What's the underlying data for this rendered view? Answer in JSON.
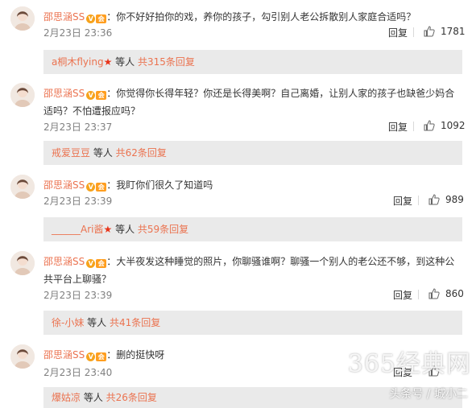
{
  "comments": [
    {
      "user": "邵思涵SS",
      "text": "：你不好好拍你的戏，养你的孩子，勾引别人老公拆散别人家庭合适吗？",
      "date": "2月23日 23:36",
      "reply_label": "回复",
      "likes": "1781",
      "sub_user": "a桐木flying",
      "sub_mid": " 等人 ",
      "sub_count": "共315条回复",
      "sub_has_star": true
    },
    {
      "user": "邵思涵SS",
      "text": "：你觉得你长得年轻？你还是长得美啊？自己离婚，让别人家的孩子也缺爸少妈合适吗？不怕遭报应吗？",
      "date": "2月23日 23:37",
      "reply_label": "回复",
      "likes": "1092",
      "sub_user": "戒爱豆豆",
      "sub_mid": " 等人 ",
      "sub_count": "共62条回复",
      "sub_has_star": false
    },
    {
      "user": "邵思涵SS",
      "text": "：我盯你们很久了知道吗",
      "date": "2月23日 23:39",
      "reply_label": "回复",
      "likes": "989",
      "sub_user": "______Ari酱",
      "sub_mid": " 等人 ",
      "sub_count": "共59条回复",
      "sub_has_star": true
    },
    {
      "user": "邵思涵SS",
      "text": "：大半夜发这种睡觉的照片，你聊骚谁啊？聊骚一个别人的老公还不够，到这种公共平台上聊骚？",
      "date": "2月23日 23:39",
      "reply_label": "回复",
      "likes": "860",
      "sub_user": "徐-小妹",
      "sub_mid": " 等人 ",
      "sub_count": "共41条回复",
      "sub_has_star": false
    },
    {
      "user": "邵思涵SS",
      "text": "：删的挺快呀",
      "date": "2月23日 23:40",
      "reply_label": "回复",
      "likes": "",
      "sub_user": "爆姑凉",
      "sub_mid": " 等人 ",
      "sub_count": "共26条回复",
      "sub_has_star": false
    }
  ],
  "badges": {
    "verified": "V",
    "member": "会"
  },
  "icons": {
    "like": "thumbs-up-icon",
    "star": "star-icon"
  },
  "watermark": {
    "main": "365经典网",
    "sub": "头条号 / 城小二"
  },
  "colors": {
    "username": "#eb7350",
    "date": "#808080",
    "sub_bg": "#eaeaea"
  }
}
